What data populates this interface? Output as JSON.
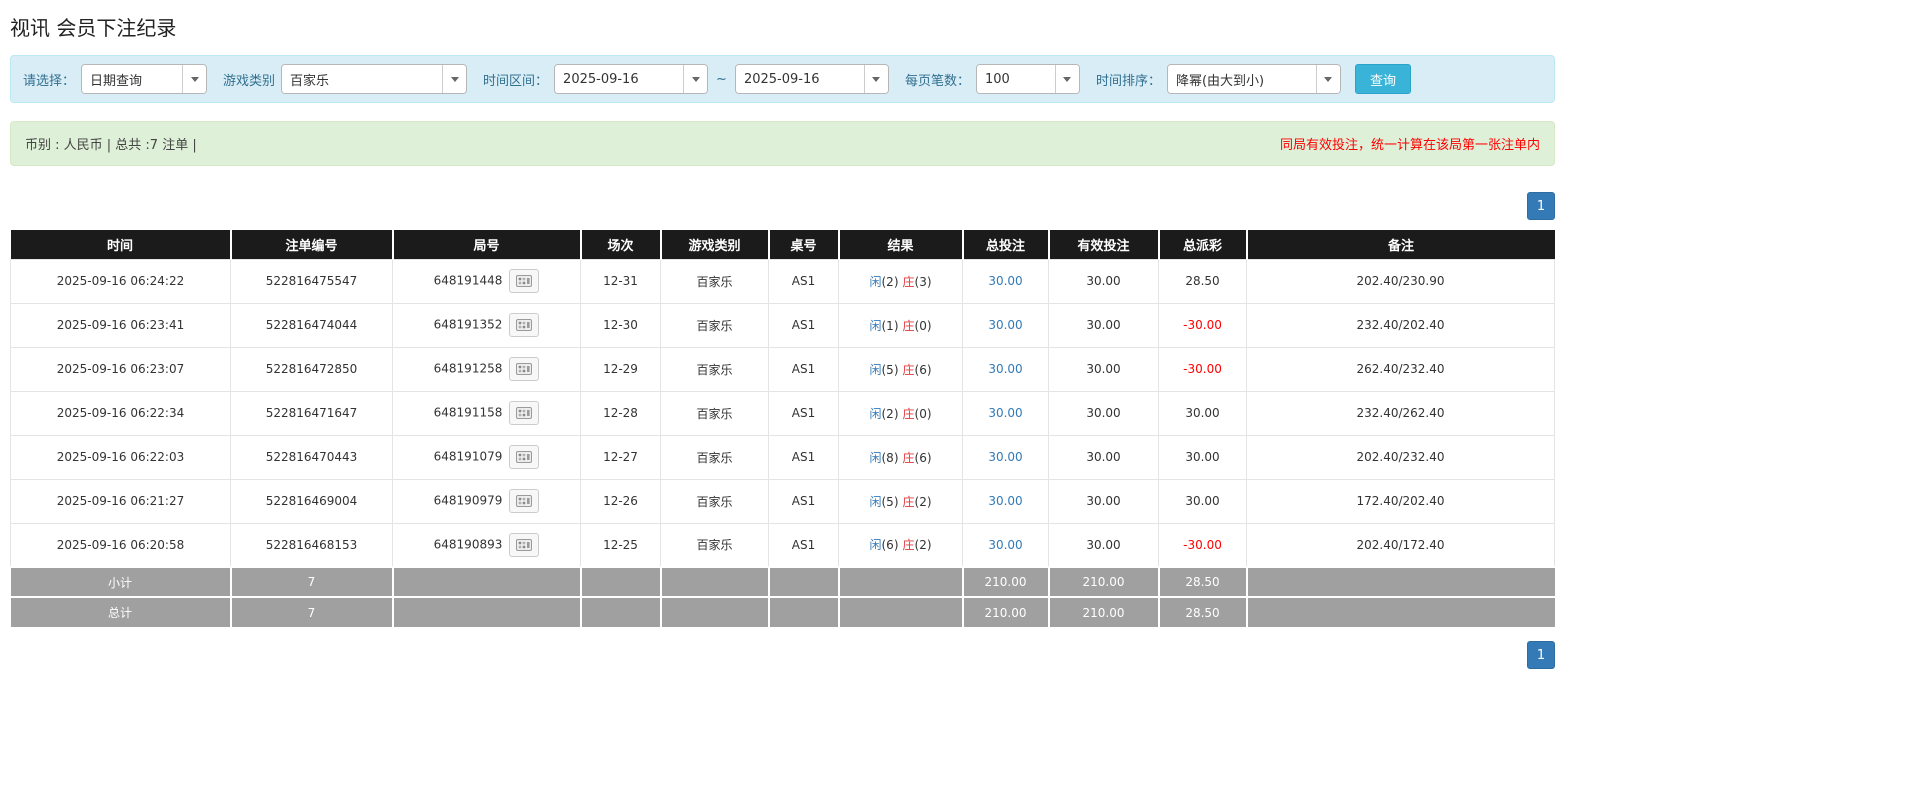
{
  "page": {
    "title": "视讯 会员下注纪录"
  },
  "filters": {
    "select_label": "请选择：",
    "select_value": "日期查询",
    "game_type_label": "游戏类别",
    "game_type_value": "百家乐",
    "time_range_label": "时间区间：",
    "date_from": "2025-09-16",
    "range_separator": "~",
    "date_to": "2025-09-16",
    "page_size_label": "每页笔数：",
    "page_size_value": "100",
    "sort_label": "时间排序：",
    "sort_value": "降幂(由大到小)",
    "search_button_label": "查询"
  },
  "summary": {
    "left_text": "币别 : 人民币 | 总共 :7 注单 |",
    "right_notice": "同局有效投注，统一计算在该局第一张注单内"
  },
  "pagination": {
    "current_page": "1"
  },
  "table": {
    "headers": [
      "时间",
      "注单编号",
      "局号",
      "场次",
      "游戏类别",
      "桌号",
      "结果",
      "总投注",
      "有效投注",
      "总派彩",
      "备注"
    ],
    "rows": [
      {
        "time": "2025-09-16 06:24:22",
        "bet_id": "522816475547",
        "round_id": "648191448",
        "session": "12-31",
        "game_type": "百家乐",
        "table_no": "AS1",
        "result": {
          "player_label": "闲",
          "player_score": "(2)",
          "banker_label": "庄",
          "banker_score": "(3)"
        },
        "total_bet": "30.00",
        "valid_bet": "30.00",
        "payout": "28.50",
        "remark": "202.40/230.90"
      },
      {
        "time": "2025-09-16 06:23:41",
        "bet_id": "522816474044",
        "round_id": "648191352",
        "session": "12-30",
        "game_type": "百家乐",
        "table_no": "AS1",
        "result": {
          "player_label": "闲",
          "player_score": "(1)",
          "banker_label": "庄",
          "banker_score": "(0)"
        },
        "total_bet": "30.00",
        "valid_bet": "30.00",
        "payout": "-30.00",
        "remark": "232.40/202.40"
      },
      {
        "time": "2025-09-16 06:23:07",
        "bet_id": "522816472850",
        "round_id": "648191258",
        "session": "12-29",
        "game_type": "百家乐",
        "table_no": "AS1",
        "result": {
          "player_label": "闲",
          "player_score": "(5)",
          "banker_label": "庄",
          "banker_score": "(6)"
        },
        "total_bet": "30.00",
        "valid_bet": "30.00",
        "payout": "-30.00",
        "remark": "262.40/232.40"
      },
      {
        "time": "2025-09-16 06:22:34",
        "bet_id": "522816471647",
        "round_id": "648191158",
        "session": "12-28",
        "game_type": "百家乐",
        "table_no": "AS1",
        "result": {
          "player_label": "闲",
          "player_score": "(2)",
          "banker_label": "庄",
          "banker_score": "(0)"
        },
        "total_bet": "30.00",
        "valid_bet": "30.00",
        "payout": "30.00",
        "remark": "232.40/262.40"
      },
      {
        "time": "2025-09-16 06:22:03",
        "bet_id": "522816470443",
        "round_id": "648191079",
        "session": "12-27",
        "game_type": "百家乐",
        "table_no": "AS1",
        "result": {
          "player_label": "闲",
          "player_score": "(8)",
          "banker_label": "庄",
          "banker_score": "(6)"
        },
        "total_bet": "30.00",
        "valid_bet": "30.00",
        "payout": "30.00",
        "remark": "202.40/232.40"
      },
      {
        "time": "2025-09-16 06:21:27",
        "bet_id": "522816469004",
        "round_id": "648190979",
        "session": "12-26",
        "game_type": "百家乐",
        "table_no": "AS1",
        "result": {
          "player_label": "闲",
          "player_score": "(5)",
          "banker_label": "庄",
          "banker_score": "(2)"
        },
        "total_bet": "30.00",
        "valid_bet": "30.00",
        "payout": "30.00",
        "remark": "172.40/202.40"
      },
      {
        "time": "2025-09-16 06:20:58",
        "bet_id": "522816468153",
        "round_id": "648190893",
        "session": "12-25",
        "game_type": "百家乐",
        "table_no": "AS1",
        "result": {
          "player_label": "闲",
          "player_score": "(6)",
          "banker_label": "庄",
          "banker_score": "(2)"
        },
        "total_bet": "30.00",
        "valid_bet": "30.00",
        "payout": "-30.00",
        "remark": "202.40/172.40"
      }
    ],
    "subtotal_row": {
      "label": "小计",
      "count": "7",
      "total_bet": "210.00",
      "valid_bet": "210.00",
      "payout": "28.50"
    },
    "total_row": {
      "label": "总计",
      "count": "7",
      "total_bet": "210.00",
      "valid_bet": "210.00",
      "payout": "28.50"
    }
  },
  "colors": {
    "accent_blue": "#337ab7",
    "player_blue": "#337ab7",
    "banker_red": "#e4393c",
    "negative_red": "#ff0000",
    "filter_bar_bg": "#d9edf7",
    "filter_label_text": "#31708f",
    "summary_bar_bg": "#dff0d8",
    "notice_red": "#ff0000",
    "table_header_bg": "#1b1b1b",
    "footer_row_bg": "#a0a0a0",
    "search_button_bg": "#39b3d7"
  }
}
